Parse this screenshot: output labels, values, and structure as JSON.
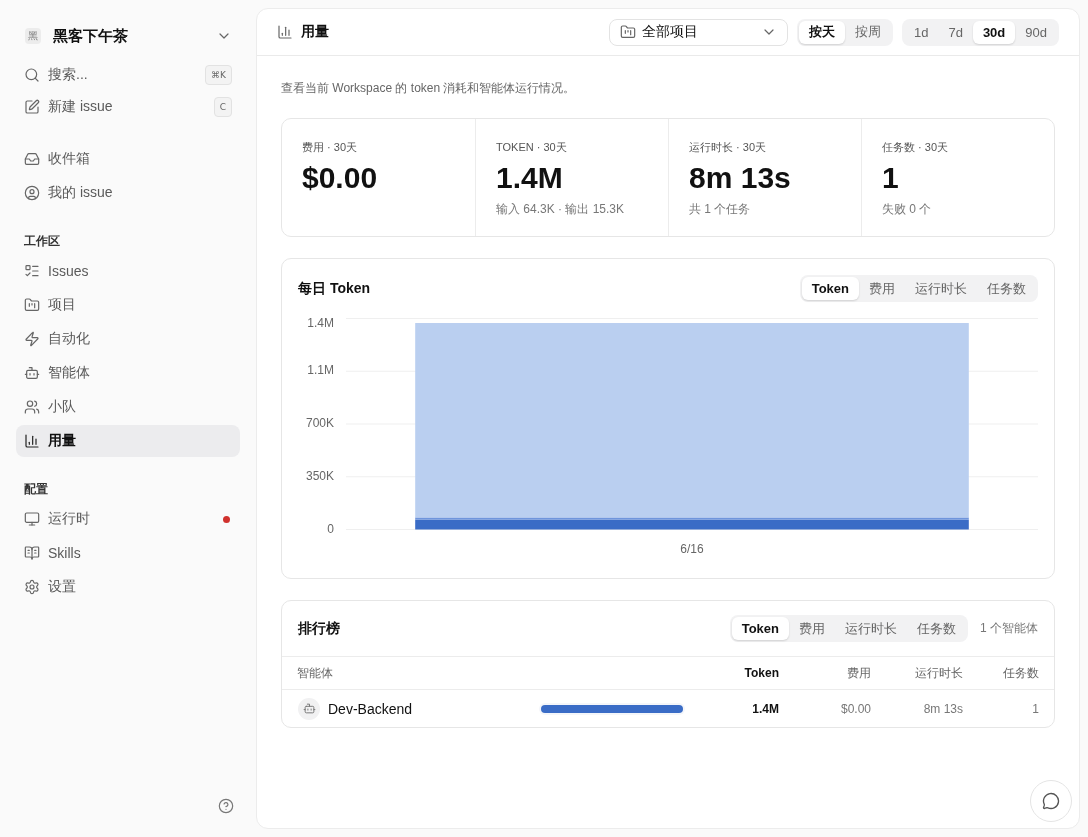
{
  "sidebar": {
    "workspace": {
      "avatar": "黑",
      "name": "黑客下午茶"
    },
    "actions": [
      {
        "label": "搜索...",
        "shortcut": "⌘K"
      },
      {
        "label": "新建 issue",
        "shortcut": "C"
      }
    ],
    "sections": [
      {
        "items": [
          {
            "label": "收件箱",
            "selected": false,
            "alert": false
          },
          {
            "label": "我的 issue",
            "selected": false,
            "alert": false
          }
        ]
      },
      {
        "title": "工作区",
        "items": [
          {
            "label": "Issues",
            "selected": false,
            "alert": false
          },
          {
            "label": "项目",
            "selected": false,
            "alert": false
          },
          {
            "label": "自动化",
            "selected": false,
            "alert": false
          },
          {
            "label": "智能体",
            "selected": false,
            "alert": false
          },
          {
            "label": "小队",
            "selected": false,
            "alert": false
          },
          {
            "label": "用量",
            "selected": true,
            "alert": false
          }
        ]
      },
      {
        "title": "配置",
        "items": [
          {
            "label": "运行时",
            "selected": false,
            "alert": true
          },
          {
            "label": "Skills",
            "selected": false,
            "alert": false
          },
          {
            "label": "设置",
            "selected": false,
            "alert": false
          }
        ]
      }
    ]
  },
  "header": {
    "title": "用量",
    "project_select": {
      "value": "全部项目"
    },
    "granularity": [
      {
        "label": "按天",
        "selected": true
      },
      {
        "label": "按周",
        "selected": false
      }
    ],
    "ranges": [
      {
        "label": "1d",
        "selected": false
      },
      {
        "label": "7d",
        "selected": false
      },
      {
        "label": "30d",
        "selected": true
      },
      {
        "label": "90d",
        "selected": false
      }
    ]
  },
  "description": "查看当前 Workspace 的 token 消耗和智能体运行情况。",
  "stats": [
    {
      "label": "费用 · 30天",
      "value": "$0.00"
    },
    {
      "label": "TOKEN · 30天",
      "value": "1.4M",
      "detail": "输入 64.3K · 输出 15.3K"
    },
    {
      "label": "运行时长 · 30天",
      "value": "8m 13s",
      "detail": "共 1 个任务"
    },
    {
      "label": "任务数 · 30天",
      "value": "1",
      "detail": "失败 0 个"
    }
  ],
  "daily_chart": {
    "title": "每日 Token",
    "tabs": [
      {
        "label": "Token",
        "selected": true
      },
      {
        "label": "费用",
        "selected": false
      },
      {
        "label": "运行时长",
        "selected": false
      },
      {
        "label": "任务数",
        "selected": false
      }
    ],
    "chart_data": {
      "type": "bar",
      "stacked": true,
      "grid": true,
      "categories": [
        "6/16"
      ],
      "series": [
        {
          "color": "#3a6cc6",
          "values": [
            65000
          ]
        },
        {
          "color": "#6f95dc",
          "values": [
            15000
          ]
        },
        {
          "color": "#bacff0",
          "values": [
            1290000
          ]
        }
      ],
      "ylim": [
        0,
        1400000
      ],
      "yticks": [
        0,
        {
          "value": 350000,
          "label": "350K"
        },
        {
          "value": 700000,
          "label": "700K"
        },
        {
          "value": 1050000,
          "label": "1.1M"
        },
        {
          "value": 1400000,
          "label": "1.4M"
        }
      ]
    }
  },
  "leaderboard": {
    "title": "排行榜",
    "tabs": [
      {
        "label": "Token",
        "selected": true
      },
      {
        "label": "费用",
        "selected": false
      },
      {
        "label": "运行时长",
        "selected": false
      },
      {
        "label": "任务数",
        "selected": false
      }
    ],
    "count": "1 个智能体",
    "columns": [
      {
        "label": "智能体",
        "sorted": false
      },
      {
        "label": "Token",
        "sorted": true
      },
      {
        "label": "费用",
        "sorted": false
      },
      {
        "label": "运行时长",
        "sorted": false
      },
      {
        "label": "任务数",
        "sorted": false
      }
    ],
    "rows": [
      {
        "name": "Dev-Backend",
        "level": 1,
        "values": [
          "1.4M",
          "$0.00",
          "8m 13s",
          "1"
        ]
      }
    ]
  }
}
